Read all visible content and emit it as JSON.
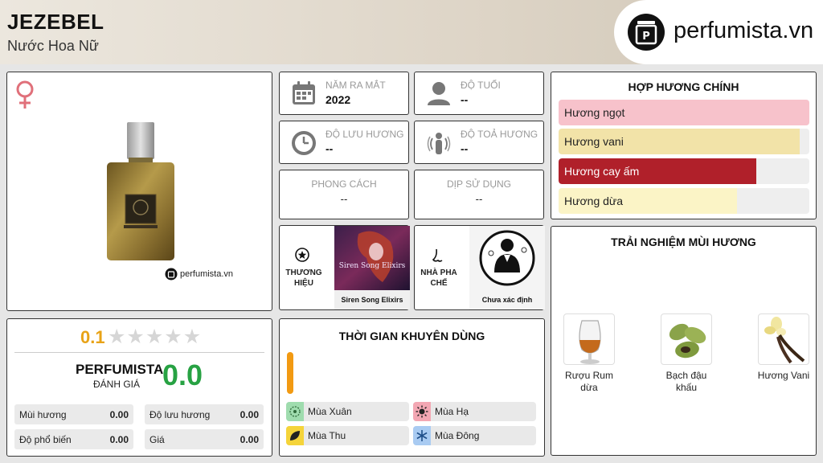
{
  "header": {
    "title": "JEZEBEL",
    "subtitle": "Nước Hoa Nữ",
    "brand": "perfumista.vn"
  },
  "product": {
    "gender_icon": "venus-icon",
    "watermark": "perfumista.vn"
  },
  "info": {
    "year": {
      "label": "NĂM RA MẮT",
      "value": "2022"
    },
    "age": {
      "label": "ĐỘ TUỔI",
      "value": "--"
    },
    "longevity": {
      "label": "ĐỘ LƯU HƯƠNG",
      "value": "--"
    },
    "sillage": {
      "label": "ĐỘ TOẢ HƯƠNG",
      "value": "--"
    },
    "style": {
      "label": "PHONG CÁCH",
      "value": "--"
    },
    "occasion": {
      "label": "DỊP SỬ DỤNG",
      "value": "--"
    }
  },
  "brand_tile": {
    "label": "THƯƠNG HIỆU",
    "name": "Siren Song Elixirs",
    "image_text": "Siren Song Elixirs"
  },
  "perfumer_tile": {
    "label": "NHÀ PHA CHẾ",
    "name": "Chưa xác định"
  },
  "accords": {
    "title": "HỢP HƯƠNG CHÍNH",
    "items": [
      {
        "label": "Hương ngọt",
        "percent": 100,
        "color": "#f7c2cb",
        "text_color": "#222222"
      },
      {
        "label": "Hương vani",
        "percent": 96,
        "color": "#f2e3a8",
        "text_color": "#222222"
      },
      {
        "label": "Hương cay ấm",
        "percent": 79,
        "color": "#b0202a",
        "text_color": "#ffffff"
      },
      {
        "label": "Hương dừa",
        "percent": 71,
        "color": "#fbf4c6",
        "text_color": "#222222"
      }
    ]
  },
  "experience": {
    "title": "TRẢI NGHIỆM MÙI HƯƠNG",
    "items": [
      {
        "label": "Rượu Rum dừa",
        "icon": "rum-glass-icon"
      },
      {
        "label": "Bạch đậu khấu",
        "icon": "cardamom-icon"
      },
      {
        "label": "Hương Vani",
        "icon": "vanilla-icon"
      }
    ]
  },
  "rating": {
    "user_score": "0.1",
    "stars_filled": 0,
    "stars_total": 5,
    "pf_label": "PERFUMISTA",
    "pf_sub": "ĐÁNH GIÁ",
    "pf_score": "0.0",
    "metrics": [
      {
        "label": "Mùi hương",
        "value": "0.00"
      },
      {
        "label": "Độ lưu hương",
        "value": "0.00"
      },
      {
        "label": "Độ phổ biến",
        "value": "0.00"
      },
      {
        "label": "Giá",
        "value": "0.00"
      }
    ]
  },
  "seasons": {
    "title": "THỜI GIAN KHUYÊN DÙNG",
    "bar_color": "#f29a12",
    "items": [
      {
        "label": "Mùa Xuân",
        "color": "#9fdcae",
        "icon": "spring-icon"
      },
      {
        "label": "Mùa Hạ",
        "color": "#f3a7b3",
        "icon": "sun-icon"
      },
      {
        "label": "Mùa Thu",
        "color": "#f5d43a",
        "icon": "leaf-icon"
      },
      {
        "label": "Mùa Đông",
        "color": "#a9cbf2",
        "icon": "snowflake-icon"
      }
    ]
  }
}
